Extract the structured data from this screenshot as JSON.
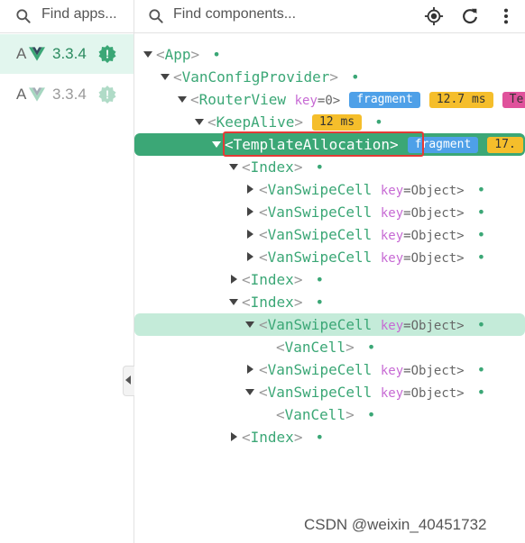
{
  "apps_panel": {
    "search_placeholder": "Find apps...",
    "apps": [
      {
        "letter": "A",
        "version": "3.3.4",
        "selected": true,
        "badge": "!"
      },
      {
        "letter": "A",
        "version": "3.3.4",
        "selected": false,
        "badge": "!"
      }
    ]
  },
  "components_panel": {
    "search_placeholder": "Find components...",
    "tools": [
      "target-icon",
      "refresh-icon",
      "more-vert-icon"
    ]
  },
  "tree": [
    {
      "name": "App",
      "expanded": true,
      "dot": "•"
    },
    {
      "name": "VanConfigProvider",
      "expanded": true,
      "dot": "•"
    },
    {
      "name": "RouterView",
      "expanded": true,
      "key": "key",
      "key_value": "=0>",
      "pills": [
        "fragment",
        "12.7 ms",
        "Te"
      ]
    },
    {
      "name": "KeepAlive",
      "expanded": true,
      "pills": [
        "12 ms"
      ],
      "dot": "•"
    },
    {
      "name": "TemplateAllocation",
      "expanded": true,
      "selected": true,
      "pills": [
        "fragment",
        "17."
      ]
    },
    {
      "name": "Index",
      "expanded": true,
      "dot": "•"
    },
    {
      "name": "VanSwipeCell",
      "expanded": false,
      "key": "key",
      "key_value": "=Object>",
      "dot": "•"
    },
    {
      "name": "VanSwipeCell",
      "expanded": false,
      "key": "key",
      "key_value": "=Object>",
      "dot": "•"
    },
    {
      "name": "VanSwipeCell",
      "expanded": false,
      "key": "key",
      "key_value": "=Object>",
      "dot": "•"
    },
    {
      "name": "VanSwipeCell",
      "expanded": false,
      "key": "key",
      "key_value": "=Object>",
      "dot": "•"
    },
    {
      "name": "Index",
      "expanded": false,
      "dot": "•"
    },
    {
      "name": "Index",
      "expanded": true,
      "dot": "•"
    },
    {
      "name": "VanSwipeCell",
      "expanded": true,
      "hovered": true,
      "key": "key",
      "key_value": "=Object>",
      "dot": "•"
    },
    {
      "name": "VanCell",
      "dot": "•"
    },
    {
      "name": "VanSwipeCell",
      "expanded": false,
      "key": "key",
      "key_value": "=Object>",
      "dot": "•"
    },
    {
      "name": "VanSwipeCell",
      "expanded": true,
      "key": "key",
      "key_value": "=Object>",
      "dot": "•"
    },
    {
      "name": "VanCell",
      "dot": "•"
    },
    {
      "name": "Index",
      "expanded": false,
      "dot": "•"
    }
  ],
  "colors": {
    "accent": "#3ba776",
    "selected_row": "#3ba776",
    "hover_row": "#c4ebd9",
    "fragment_pill": "#4ea0e8",
    "time_pill": "#f5be2b",
    "highlight_box": "#e53935"
  },
  "watermark": "CSDN @weixin_40451732"
}
